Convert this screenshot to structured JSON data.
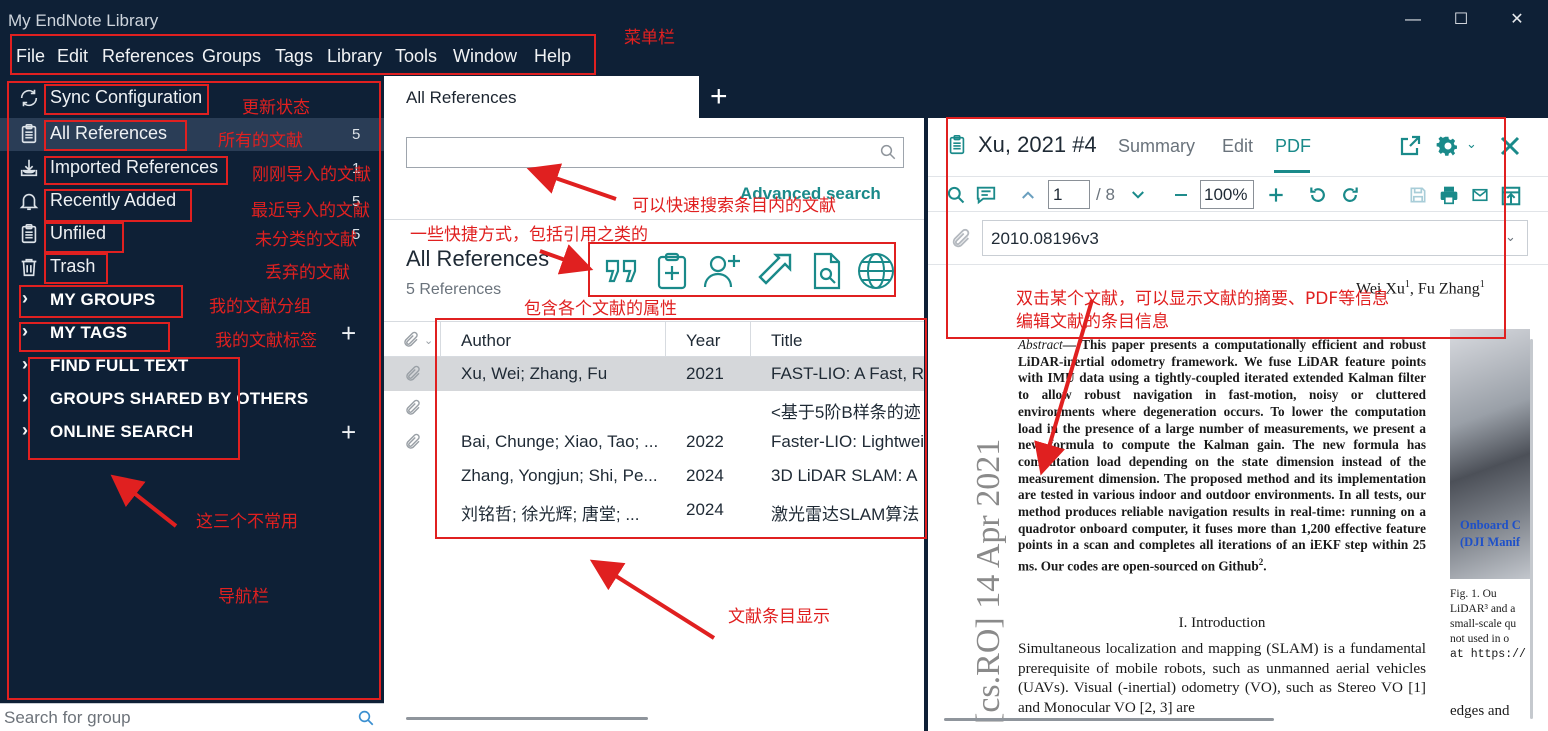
{
  "window": {
    "title": "My EndNote Library",
    "controls": [
      "—",
      "☐",
      "✕"
    ]
  },
  "menu": [
    "File",
    "Edit",
    "References",
    "Groups",
    "Tags",
    "Library",
    "Tools",
    "Window",
    "Help"
  ],
  "sidebar": {
    "items": [
      {
        "label": "Sync Configuration",
        "count": "",
        "icon": "sync-icon"
      },
      {
        "label": "All References",
        "count": "5",
        "icon": "clipboard-icon",
        "active": true
      },
      {
        "label": "Imported References",
        "count": "1",
        "icon": "import-icon"
      },
      {
        "label": "Recently Added",
        "count": "5",
        "icon": "bell-icon"
      },
      {
        "label": "Unfiled",
        "count": "5",
        "icon": "clipboard-icon"
      },
      {
        "label": "Trash",
        "count": "",
        "icon": "trash-icon"
      }
    ],
    "groups": [
      "MY GROUPS",
      "MY TAGS",
      "FIND FULL TEXT",
      "GROUPS SHARED BY OTHERS",
      "ONLINE SEARCH"
    ],
    "search_placeholder": "Search for group"
  },
  "middle": {
    "tab_label": "All References",
    "add_tab": "+",
    "advanced_search": "Advanced search",
    "heading": "All References",
    "subheading": "5 References",
    "toolbar_icons": [
      "quote-icon",
      "clipboard-add-icon",
      "add-user-icon",
      "share-arrow-icon",
      "find-pdf-icon",
      "globe-icon"
    ],
    "columns": [
      "Author",
      "Year",
      "Title"
    ],
    "rows": [
      {
        "author": "Xu, Wei; Zhang, Fu",
        "year": "2021",
        "title": "FAST-LIO: A Fast, Ro",
        "attachment": true,
        "selected": true
      },
      {
        "author": "",
        "year": "",
        "title": "<基于5阶B样条的迹",
        "attachment": true,
        "selected": false
      },
      {
        "author": "Bai, Chunge; Xiao, Tao; ...",
        "year": "2022",
        "title": "Faster-LIO: Lightwei",
        "attachment": true,
        "selected": false
      },
      {
        "author": "Zhang, Yongjun; Shi, Pe...",
        "year": "2024",
        "title": "3D LiDAR SLAM: A",
        "attachment": false,
        "selected": false
      },
      {
        "author": "刘铭哲; 徐光辉; 唐堂; ...",
        "year": "2024",
        "title": "激光雷达SLAM算法",
        "attachment": false,
        "selected": false
      }
    ]
  },
  "right": {
    "ref_title": "Xu, 2021 #4",
    "tabs": [
      "Summary",
      "Edit",
      "PDF"
    ],
    "active_tab": "PDF",
    "page_current": "1",
    "page_total": "/ 8",
    "zoom": "100%",
    "attachment_name": "2010.08196v3",
    "pdf": {
      "side_stamp": "[cs.RO]  14 Apr 2021",
      "authors": "Wei Xu",
      "authors_sup": "1",
      "authors_sep": ", Fu Zhang",
      "authors_sup2": "1",
      "abstract_lead": "Abstract",
      "abstract_body": "— This paper presents a computationally efficient and robust LiDAR-inertial odometry framework. We fuse LiDAR feature points with IMU data using a tightly-coupled iterated extended Kalman filter to allow robust navigation in fast-motion, noisy or cluttered environments where degeneration occurs. To lower the computation load in the presence of a large number of measurements, we present a new formula to compute the Kalman gain. The new formula has computation load depending on the state dimension instead of the measurement dimension. The proposed method and its implementation are tested in various indoor and outdoor environments. In all tests, our method produces reliable navigation results in real-time: running on a quadrotor onboard computer, it fuses more than 1,200 effective feature points in a scan and completes all iterations of an iEKF step within 25 ms. Our codes are open-sourced on Github",
      "abstract_sup": "2",
      "abstract_end": ".",
      "section": "I. Introduction",
      "body": "Simultaneous localization and mapping (SLAM) is a fundamental prerequisite of mobile robots, such as unmanned aerial vehicles (UAVs). Visual (-inertial) odometry (VO), such as Stereo VO [1] and Monocular VO [2, 3] are",
      "fig_text_1": "Onboard C",
      "fig_text_2": "(DJI Manif",
      "fig_caption": [
        "Fig. 1.    Ou",
        "LiDAR³ and a",
        "small-scale qu",
        "not used in o",
        "at https://"
      ],
      "fig_caption_tail": "edges and"
    }
  },
  "annotations": {
    "menu": "菜单栏",
    "sync": "更新状态",
    "all_refs": "所有的文献",
    "imported": "刚刚导入的文献",
    "recent": "最近导入的文献",
    "unfiled": "未分类的文献",
    "trash": "丢弃的文献",
    "groups": "我的文献分组",
    "tags": "我的文献标签",
    "rare": "这三个不常用",
    "nav": "导航栏",
    "search": "可以快速搜索条目内的文献",
    "shortcuts": "一些快捷方式，包括引用之类的",
    "attrs": "包含各个文献的属性",
    "entries": "文献条目显示",
    "detail_1": "双击某个文献，可以显示文献的摘要、PDF等信息",
    "detail_2": "编辑文献的条目信息"
  },
  "colors": {
    "chrome": "#0e2036",
    "accent": "#1a8a8a",
    "annotation": "#e02020"
  }
}
